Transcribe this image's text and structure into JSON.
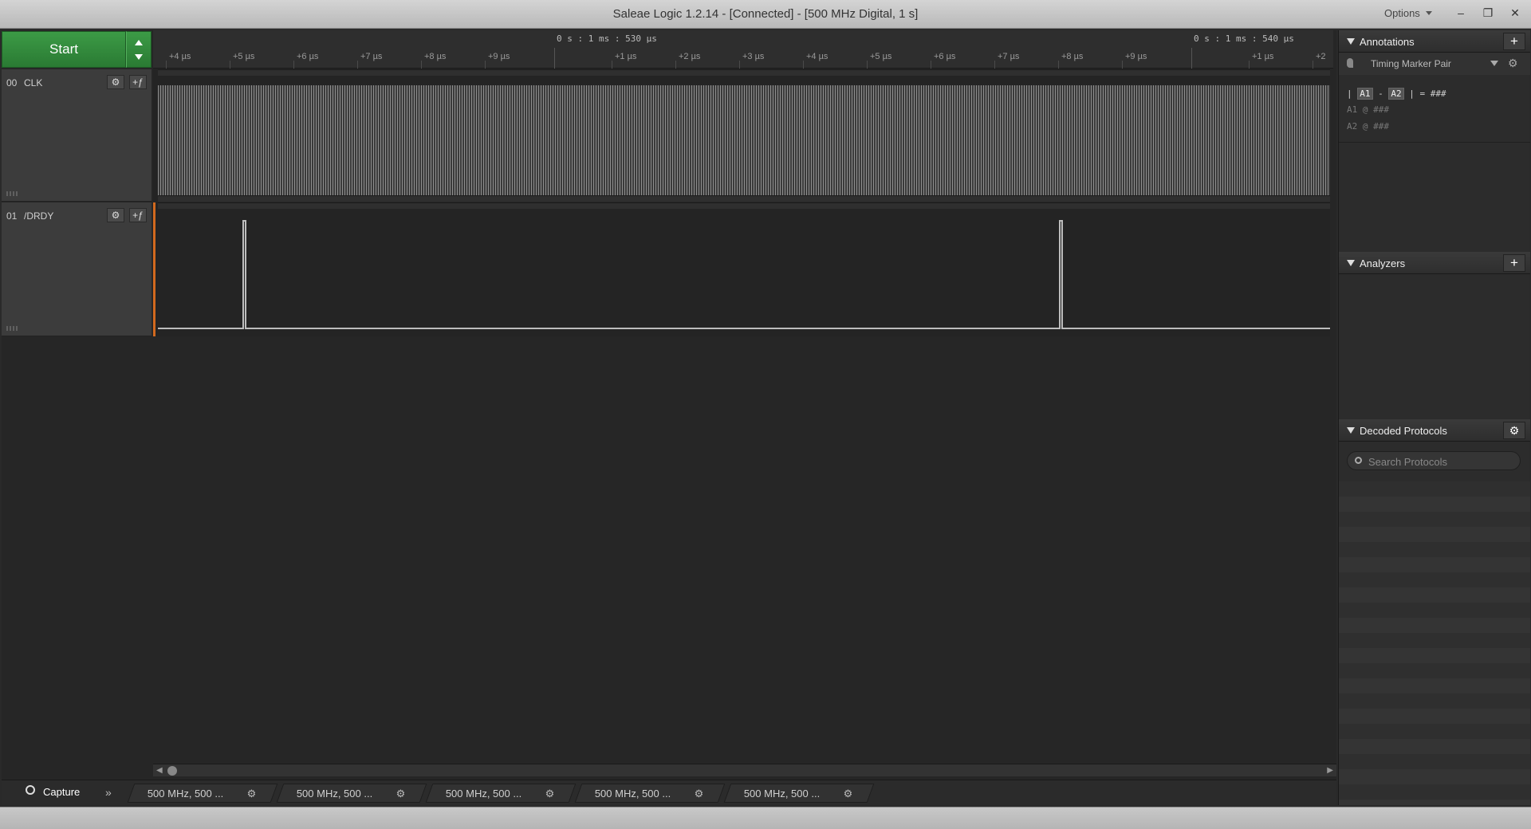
{
  "window": {
    "title": "Saleae Logic 1.2.14 - [Connected] - [500 MHz Digital, 1 s]",
    "options_label": "Options",
    "minimize": "–",
    "restore": "❐",
    "close": "✕"
  },
  "toolbar": {
    "start_label": "Start"
  },
  "ruler": {
    "timestamp_left": "0 s : 1 ms : 530 µs",
    "timestamp_right": "0 s : 1 ms : 540 µs",
    "ticks": [
      "+4 µs",
      "+5 µs",
      "+6 µs",
      "+7 µs",
      "+8 µs",
      "+9 µs",
      "+1 µs",
      "+2 µs",
      "+3 µs",
      "+4 µs",
      "+5 µs",
      "+6 µs",
      "+7 µs",
      "+8 µs",
      "+9 µs",
      "+1 µs",
      "+2"
    ]
  },
  "channels": [
    {
      "number": "00",
      "name": "CLK",
      "gear": "⚙",
      "trigger": "+ƒ"
    },
    {
      "number": "01",
      "name": "/DRDY",
      "gear": "⚙",
      "trigger": "+ƒ"
    }
  ],
  "tabs": {
    "capture_label": "Capture",
    "overflow": "»",
    "sessions": [
      "500 MHz, 500 ...",
      "500 MHz, 500 ...",
      "500 MHz, 500 ...",
      "500 MHz, 500 ...",
      "500 MHz, 500 ..."
    ],
    "gear": "⚙"
  },
  "sidebar": {
    "annotations": {
      "title": "Annotations",
      "add": "+",
      "marker_label": "Timing Marker Pair",
      "gear": "⚙",
      "line1_pre": "|",
      "a1": "A1",
      "minus": "-",
      "a2": "A2",
      "line1_post": "| = ###",
      "line2": "A1  @  ###",
      "line3": "A2  @  ###"
    },
    "analyzers": {
      "title": "Analyzers",
      "add": "+"
    },
    "decoded": {
      "title": "Decoded Protocols",
      "gear": "⚙",
      "search_placeholder": "Search Protocols"
    }
  },
  "colors": {
    "start_green": "#2e8a38",
    "cursor_orange": "#d2691e"
  }
}
